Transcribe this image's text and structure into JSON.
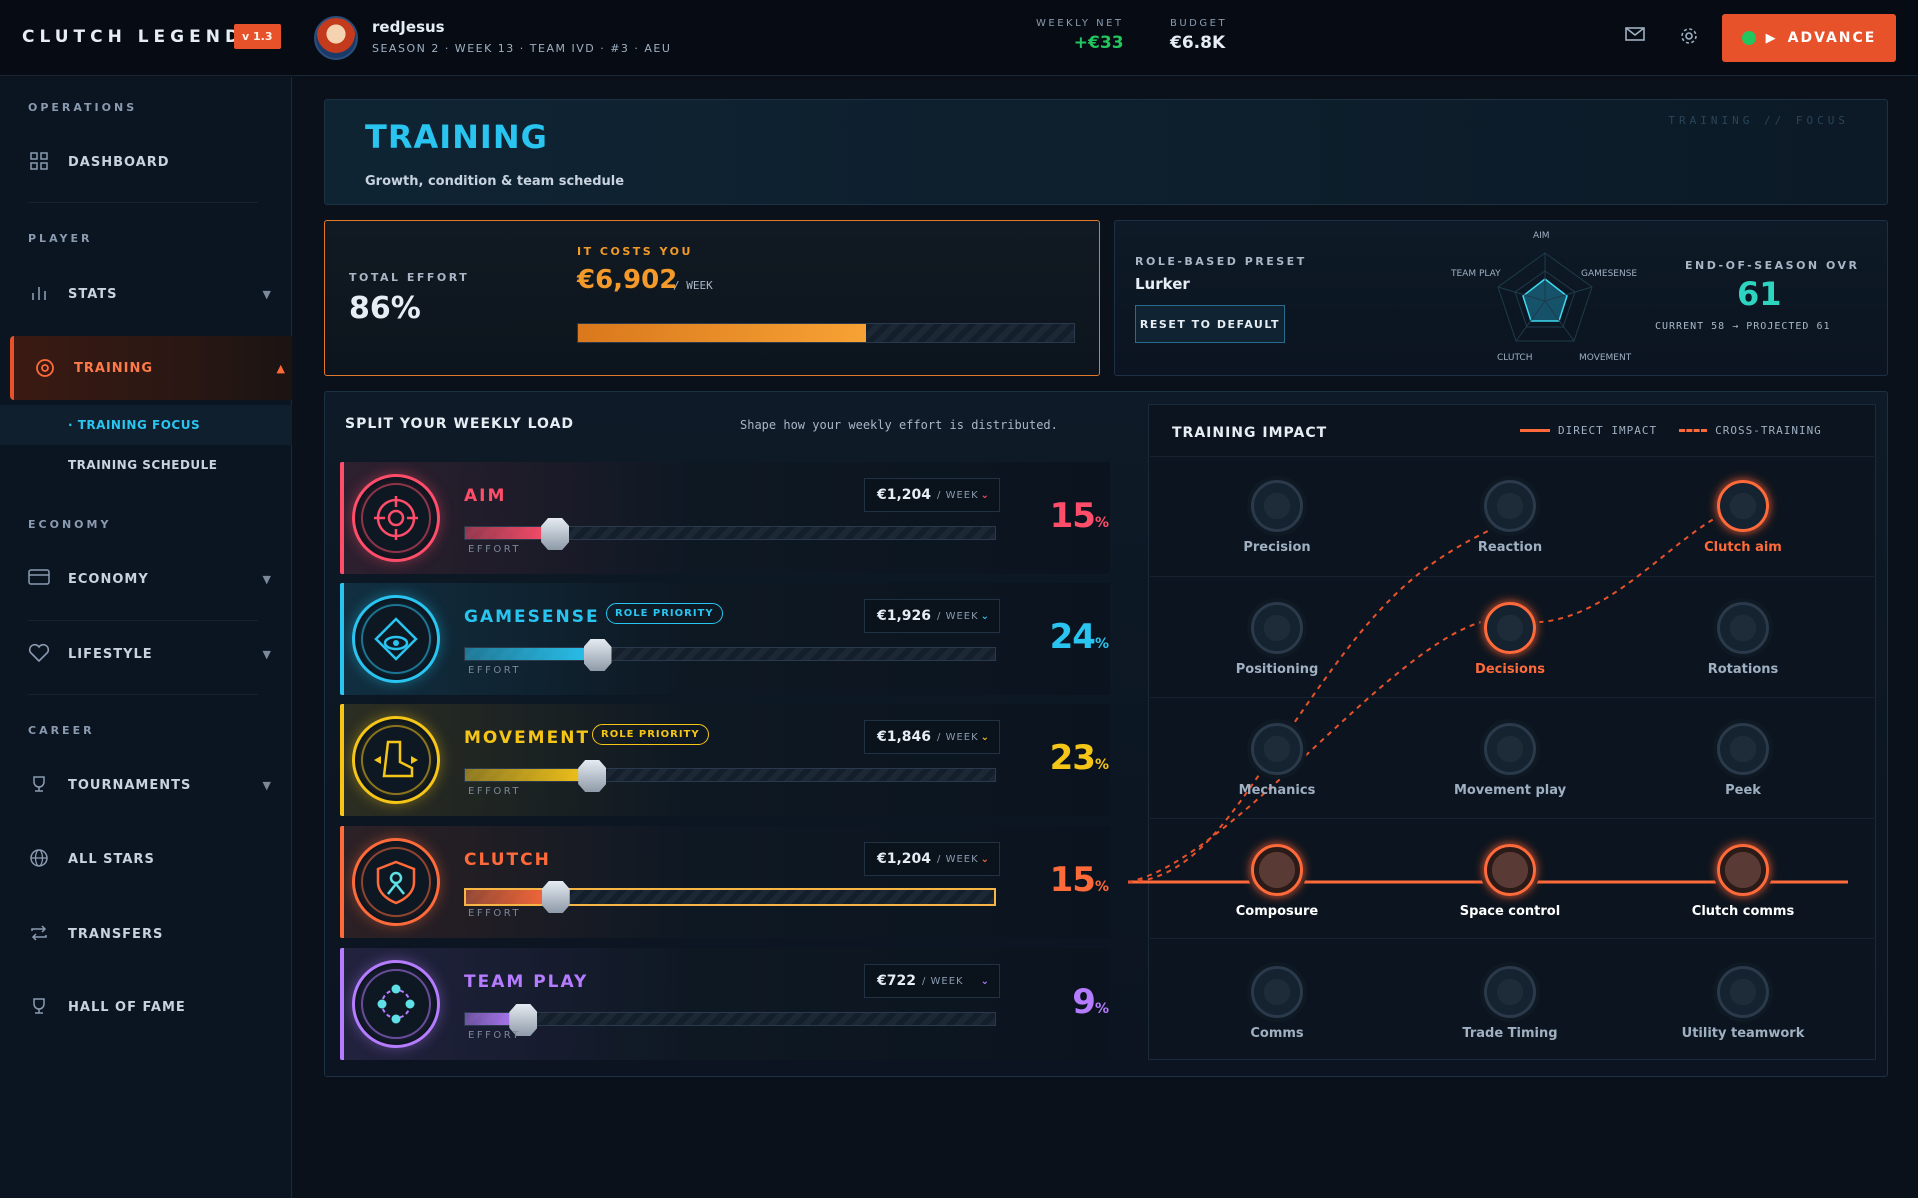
{
  "topbar": {
    "logo": "CLUTCH LEGEND",
    "version": "v 1.3",
    "username": "redJesus",
    "subline": "SEASON 2 · WEEK 13 · TEAM IVD · #3 · AEU",
    "weekly_net_label": "WEEKLY NET",
    "weekly_net_value": "+€33",
    "budget_label": "BUDGET",
    "budget_value": "€6.8K",
    "advance_label": "ADVANCE",
    "icons": [
      "mail-icon",
      "gear-icon",
      "play-icon"
    ]
  },
  "sidebar": {
    "sections": {
      "operations": "OPERATIONS",
      "player": "PLAYER",
      "economy": "ECONOMY",
      "career": "CAREER"
    },
    "items": {
      "dashboard": "DASHBOARD",
      "stats": "STATS",
      "training": "TRAINING",
      "training_focus": "· TRAINING FOCUS",
      "training_schedule": "TRAINING SCHEDULE",
      "economy": "ECONOMY",
      "lifestyle": "LIFESTYLE",
      "tournaments": "TOURNAMENTS",
      "all_stars": "ALL STARS",
      "transfers": "TRANSFERS",
      "hall_of_fame": "HALL OF FAME"
    }
  },
  "header": {
    "title": "TRAINING",
    "subtitle": "Growth, condition & team schedule",
    "tag": "TRAINING // FOCUS"
  },
  "effort": {
    "total_label": "TOTAL EFFORT",
    "total_value": "86%",
    "cost_label": "IT COSTS YOU",
    "cost_value": "€6,902",
    "cost_unit": "/ WEEK",
    "fill_fraction": 0.58,
    "accent": "#f39a2a"
  },
  "preset": {
    "label": "ROLE-BASED PRESET",
    "value": "Lurker",
    "reset_label": "RESET TO DEFAULT",
    "radar_labels": {
      "aim": "AIM",
      "gamesense": "GAMESENSE",
      "movement": "MOVEMENT",
      "clutch": "CLUTCH",
      "team_play": "TEAM PLAY"
    },
    "ovr_label": "END-OF-SEASON OVR",
    "ovr_value": "61",
    "ovr_detail": "CURRENT 58 → PROJECTED 61"
  },
  "split": {
    "title": "SPLIT YOUR WEEKLY LOAD",
    "hint": "Shape how your weekly effort is distributed.",
    "effort_label": "EFFORT",
    "unit": "/ WEEK",
    "rows": [
      {
        "name": "AIM",
        "badge": "",
        "cost": "€1,204",
        "pct": "15",
        "fraction": 0.17,
        "color": "#ff4d6a",
        "icon": "crosshair-icon"
      },
      {
        "name": "GAMESENSE",
        "badge": "ROLE PRIORITY",
        "cost": "€1,926",
        "pct": "24",
        "fraction": 0.25,
        "color": "#29c4f0",
        "icon": "eye-icon"
      },
      {
        "name": "MOVEMENT",
        "badge": "ROLE PRIORITY",
        "cost": "€1,846",
        "pct": "23",
        "fraction": 0.24,
        "color": "#f5c518",
        "icon": "boot-icon"
      },
      {
        "name": "CLUTCH",
        "badge": "",
        "cost": "€1,204",
        "pct": "15",
        "fraction": 0.17,
        "color": "#ff6a3a",
        "icon": "shield-icon"
      },
      {
        "name": "TEAM PLAY",
        "badge": "",
        "cost": "€722",
        "pct": "9",
        "fraction": 0.11,
        "color": "#b57cff",
        "icon": "team-icon"
      }
    ]
  },
  "impact": {
    "title": "TRAINING IMPACT",
    "legend_direct": "DIRECT IMPACT",
    "legend_cross": "CROSS-TRAINING",
    "nodes": [
      {
        "label": "Precision",
        "state": "off"
      },
      {
        "label": "Reaction",
        "state": "off"
      },
      {
        "label": "Clutch aim",
        "state": "cross"
      },
      {
        "label": "Positioning",
        "state": "off"
      },
      {
        "label": "Decisions",
        "state": "cross"
      },
      {
        "label": "Rotations",
        "state": "off"
      },
      {
        "label": "Mechanics",
        "state": "off"
      },
      {
        "label": "Movement play",
        "state": "off"
      },
      {
        "label": "Peek",
        "state": "off"
      },
      {
        "label": "Composure",
        "state": "direct"
      },
      {
        "label": "Space control",
        "state": "direct"
      },
      {
        "label": "Clutch comms",
        "state": "direct"
      },
      {
        "label": "Comms",
        "state": "off"
      },
      {
        "label": "Trade Timing",
        "state": "off"
      },
      {
        "label": "Utility teamwork",
        "state": "off"
      }
    ]
  }
}
